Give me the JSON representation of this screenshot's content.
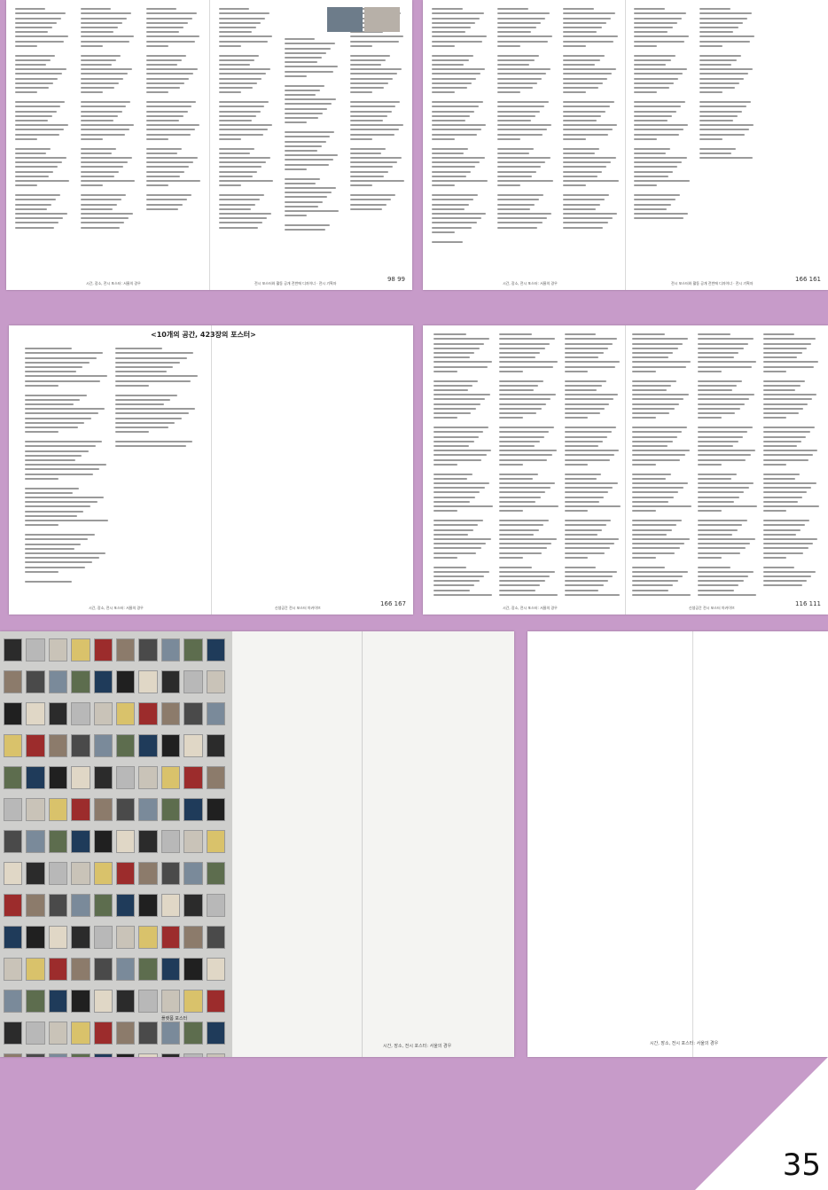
{
  "spread1": {
    "folio": "98 99",
    "footer_left": "시간, 장소, 전시 포스터: 서울의 경우",
    "footer_right": "전시 포스터와 활동 공개 전반에 디자이너 · 전시 기획자"
  },
  "spread2": {
    "folio": "166 161",
    "footer_left": "시간, 장소, 전시 포스터: 서울의 경우",
    "footer_right": "전시 포스터와 활동 공개 전반에 디자이너 · 전시 기획자"
  },
  "spread3": {
    "title": "<10개의 공간, 423장의 포스터>",
    "folio": "166 167",
    "footer_left": "시간, 장소, 전시 포스터: 서울의 경우",
    "footer_right": "신생공간 전시 포스터 아카이브"
  },
  "spread4": {
    "folio": "116 111",
    "footer_left": "시간, 장소, 전시 포스터: 서울의 경우",
    "footer_right": "신생공간 전시 포스터 아카이브"
  },
  "spread5": {
    "caption": "플랫폼 포스터",
    "footer": "시간, 장소, 전시 포스터: 서울의 경우"
  },
  "page6": {
    "footer": "시간, 장소, 전시 포스터: 서울의 경우"
  },
  "page_number": "35",
  "colors": {
    "background": "#c79bc9",
    "paper": "#ffffff"
  }
}
